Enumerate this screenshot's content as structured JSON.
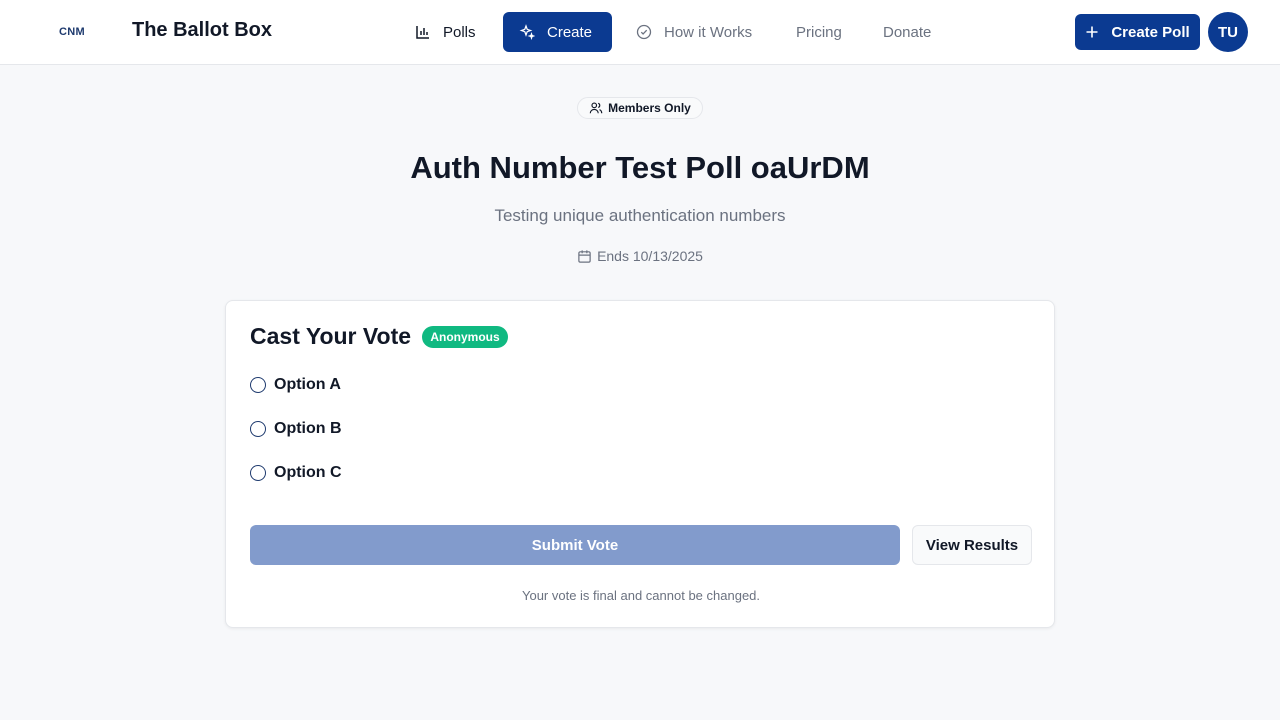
{
  "header": {
    "logo_text": "CNM",
    "brand": "The Ballot Box",
    "nav": [
      {
        "label": "Polls",
        "icon": "bar-chart-icon"
      },
      {
        "label": "Create",
        "icon": "sparkles-icon",
        "active": true
      },
      {
        "label": "How it Works",
        "icon": "check-circle-icon"
      },
      {
        "label": "Pricing"
      },
      {
        "label": "Donate"
      }
    ],
    "create_poll_label": "Create Poll",
    "create_poll_icon": "plus-icon",
    "avatar_initials": "TU"
  },
  "poll": {
    "access_badge": "Members Only",
    "access_icon": "users-icon",
    "title": "Auth Number Test Poll oaUrDM",
    "subtitle": "Testing unique authentication numbers",
    "ends_label": "Ends 10/13/2025",
    "ends_icon": "calendar-icon"
  },
  "vote_card": {
    "title": "Cast Your Vote",
    "anonymous_badge": "Anonymous",
    "options": [
      "Option A",
      "Option B",
      "Option C"
    ],
    "submit_label": "Submit Vote",
    "view_results_label": "View Results",
    "note": "Your vote is final and cannot be changed."
  },
  "colors": {
    "primary": "#0b3a91",
    "primary_disabled": "#829bcc",
    "anonymous_badge": "#10b981",
    "background": "#f7f8fa"
  }
}
